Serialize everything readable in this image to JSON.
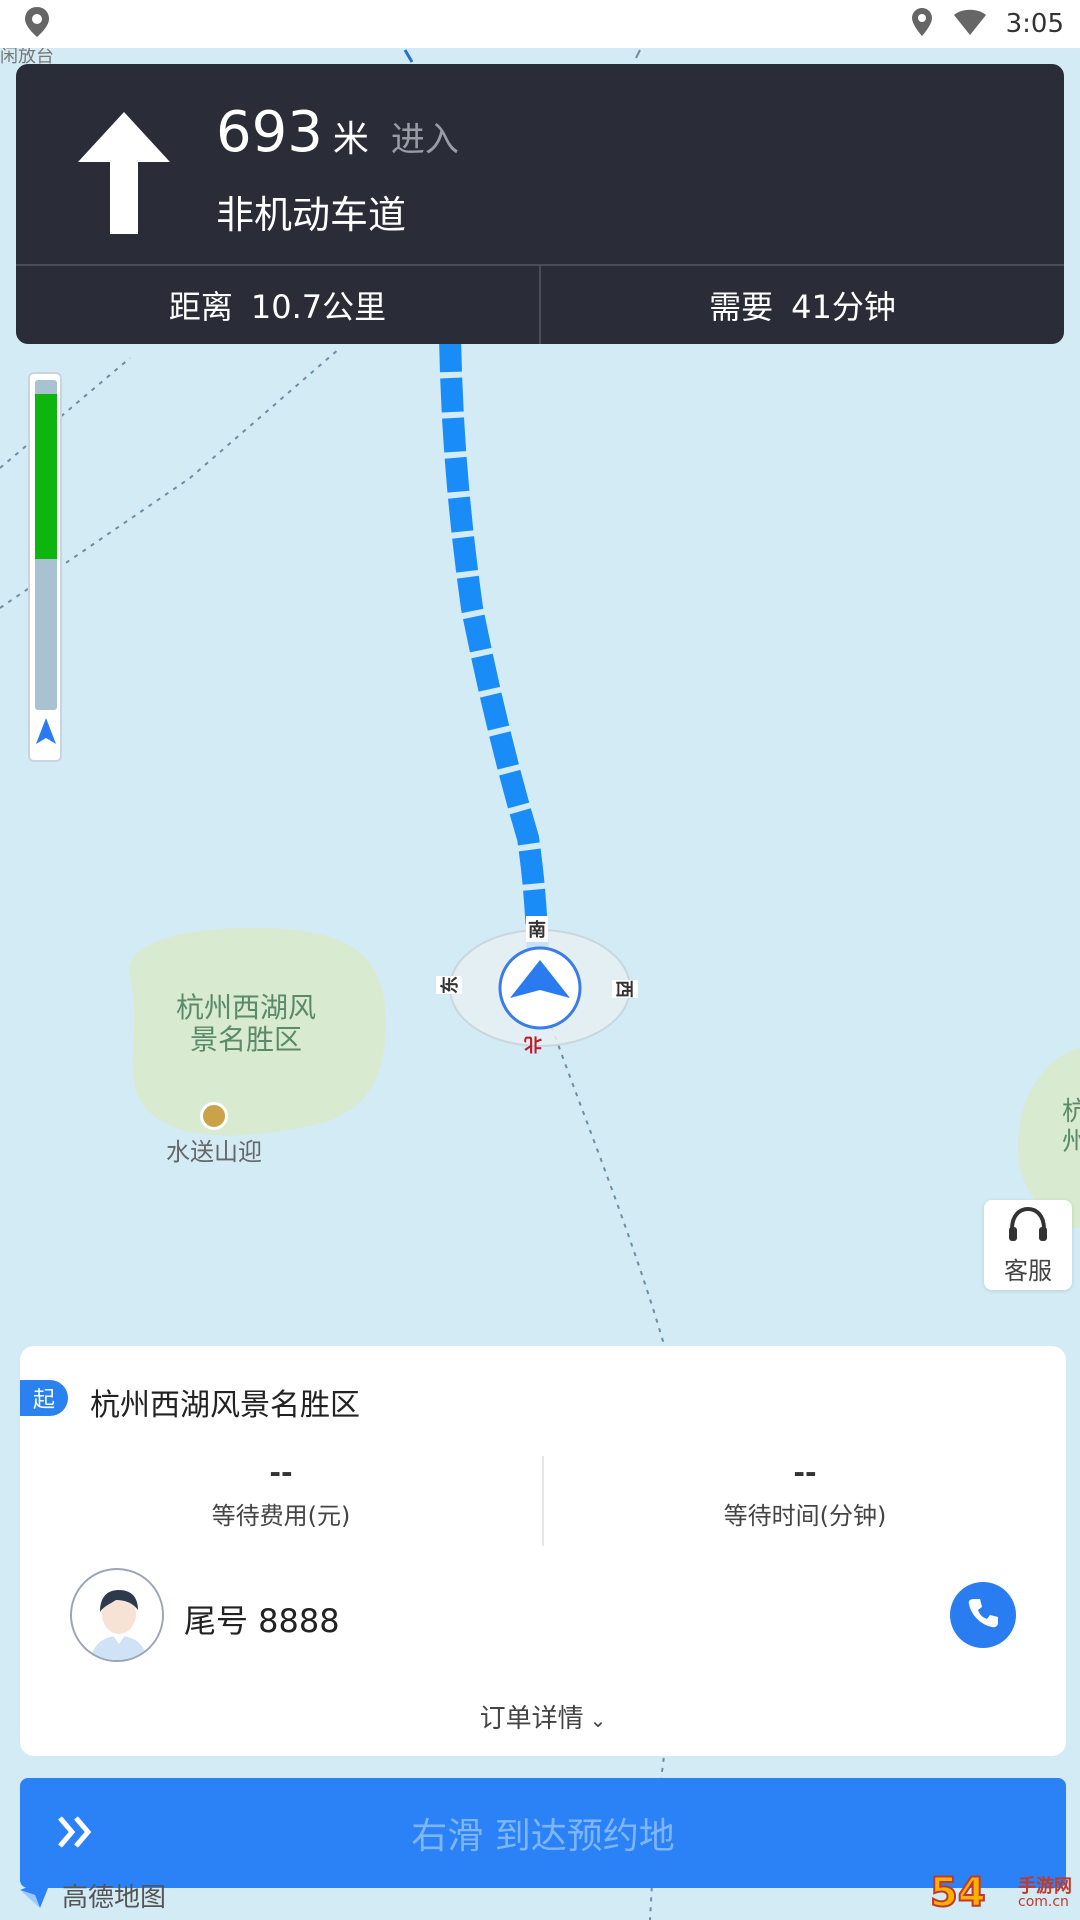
{
  "status_bar": {
    "time": "3:05",
    "icons": [
      "location-icon",
      "location-icon",
      "wifi-icon"
    ]
  },
  "map": {
    "labels": {
      "scenic_area": "杭州西湖风\n景名胜区",
      "poi": "水送山迎",
      "top_left": "闲放台",
      "edge_right": "杭\n州"
    },
    "compass": {
      "north": "南",
      "south": "北",
      "east": "西",
      "west": "东"
    },
    "colors": {
      "water": "#d3ebf5",
      "park": "#d8ead0",
      "route": "#1a8cf7"
    }
  },
  "navigation": {
    "distance_value": "693",
    "distance_unit": "米",
    "action": "进入",
    "road": "非机动车道",
    "total_label": "距离",
    "total_value": "10.7公里",
    "time_label": "需要",
    "time_value": "41分钟",
    "arrow_icon": "arrow-up-icon"
  },
  "route_progress": {
    "traveled_fraction": 0.5,
    "colors": {
      "traveled": "#0fb50f",
      "remaining": "#a9c2d2"
    }
  },
  "customer_service": {
    "label": "客服",
    "icon": "headset-icon"
  },
  "order": {
    "start_tag": "起",
    "start_name": "杭州西湖风景名胜区",
    "wait_fee_value": "--",
    "wait_fee_label": "等待费用(元)",
    "wait_time_value": "--",
    "wait_time_label": "等待时间(分钟)",
    "plate_label": "尾号 8888",
    "detail_label": "订单详情",
    "call_icon": "phone-icon"
  },
  "slide": {
    "label": "右滑 到达预约地",
    "icon": "double-chevron-right-icon"
  },
  "brand": {
    "name": "高德地图"
  },
  "watermark": {
    "digits": "54",
    "text": "手游网",
    "domain": "com.cn"
  }
}
